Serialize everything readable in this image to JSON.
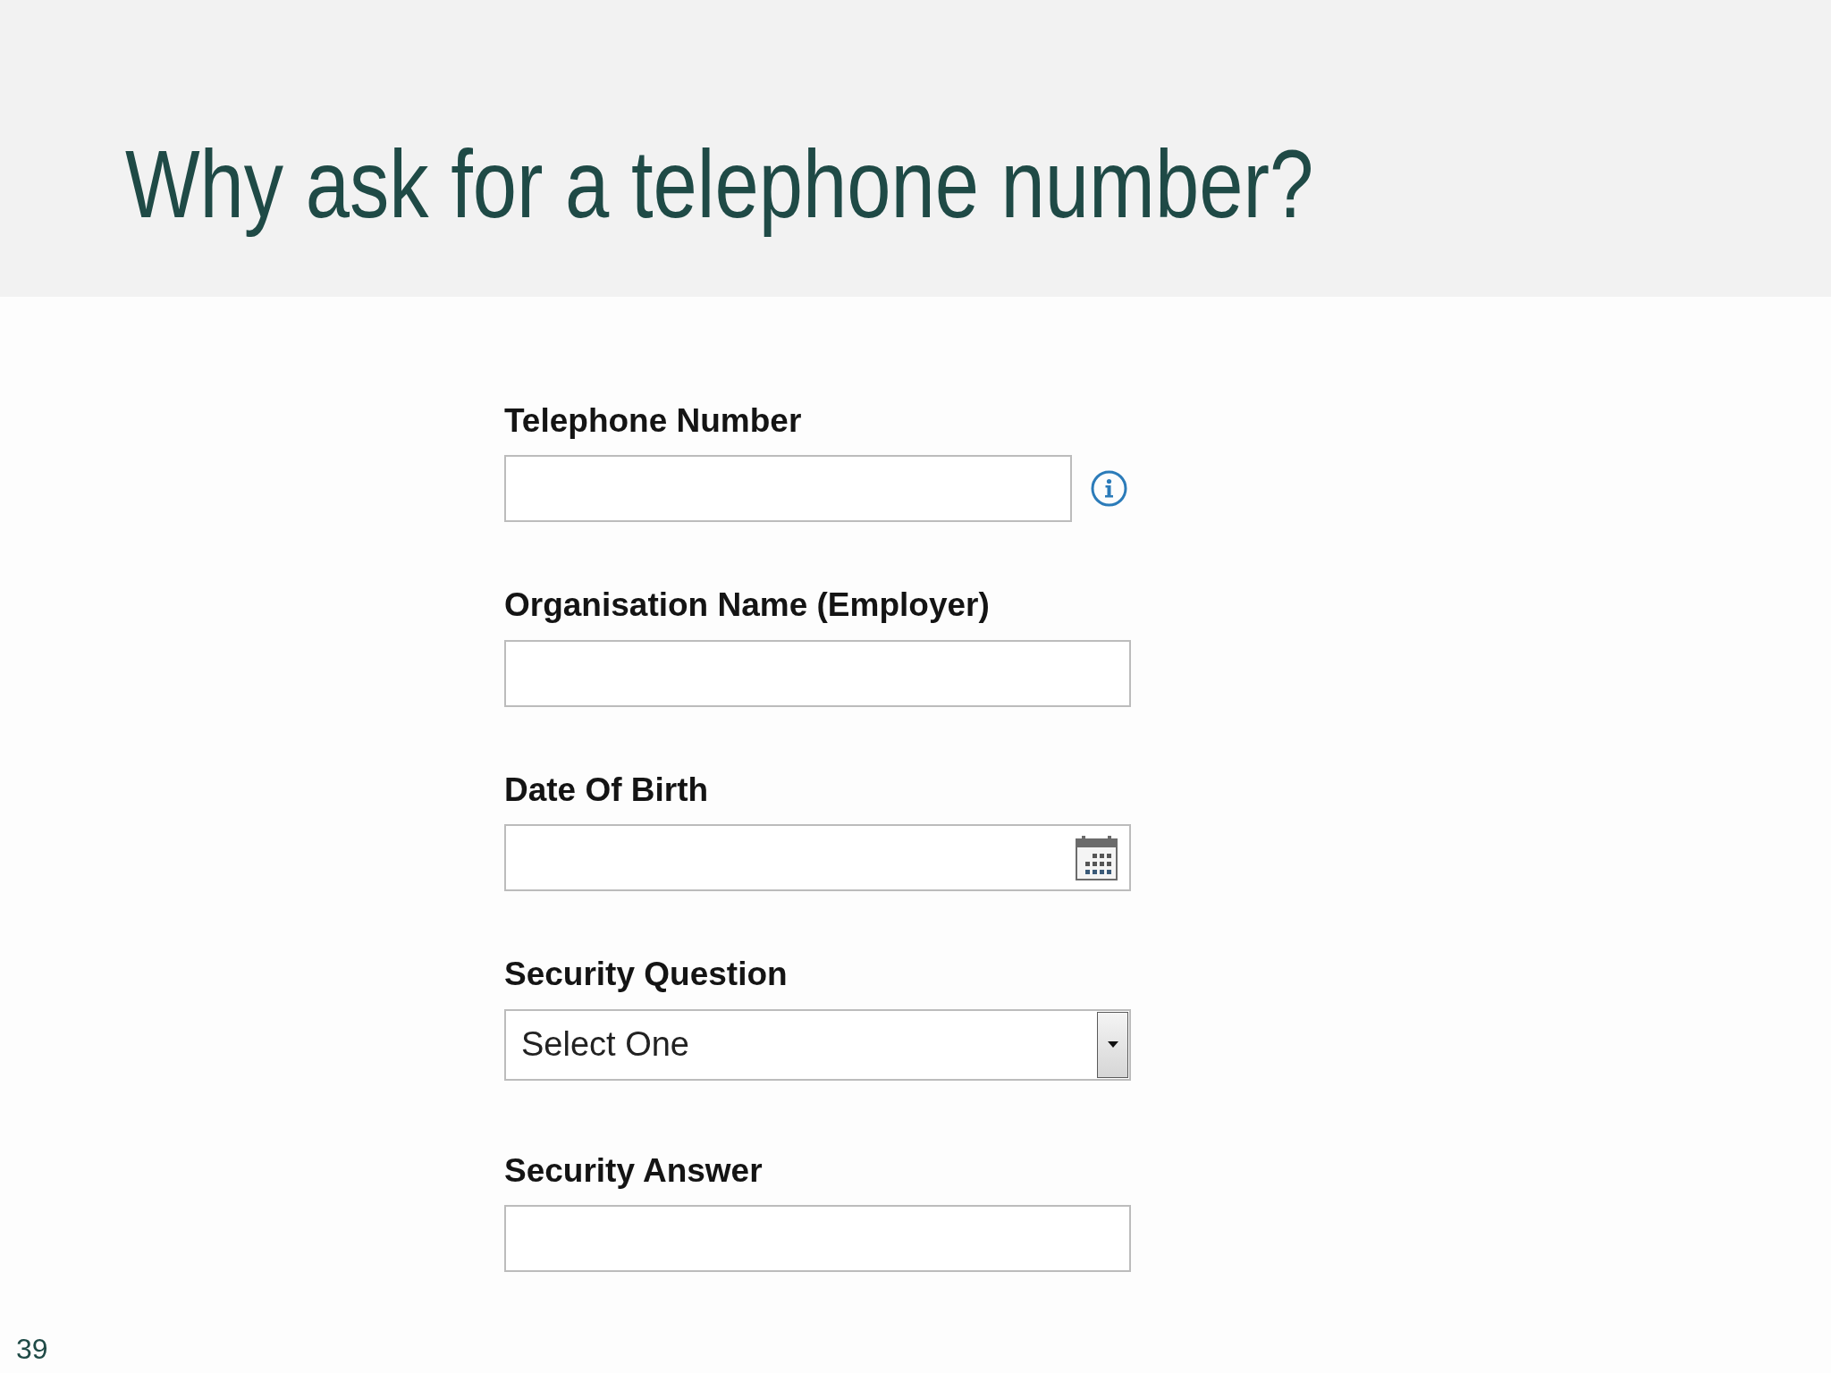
{
  "slide": {
    "title": "Why ask for a telephone number?",
    "page_number": "39"
  },
  "form": {
    "fields": [
      {
        "kind": "text",
        "label": "Telephone Number",
        "info_icon": true
      },
      {
        "kind": "text",
        "label": "Organisation Name (Employer)",
        "info_icon": false
      },
      {
        "kind": "date",
        "label": "Date Of Birth",
        "info_icon": false
      },
      {
        "kind": "select",
        "label": "Security Question",
        "value": "Select One",
        "info_icon": false
      },
      {
        "kind": "text",
        "label": "Security Answer",
        "info_icon": false
      }
    ]
  }
}
